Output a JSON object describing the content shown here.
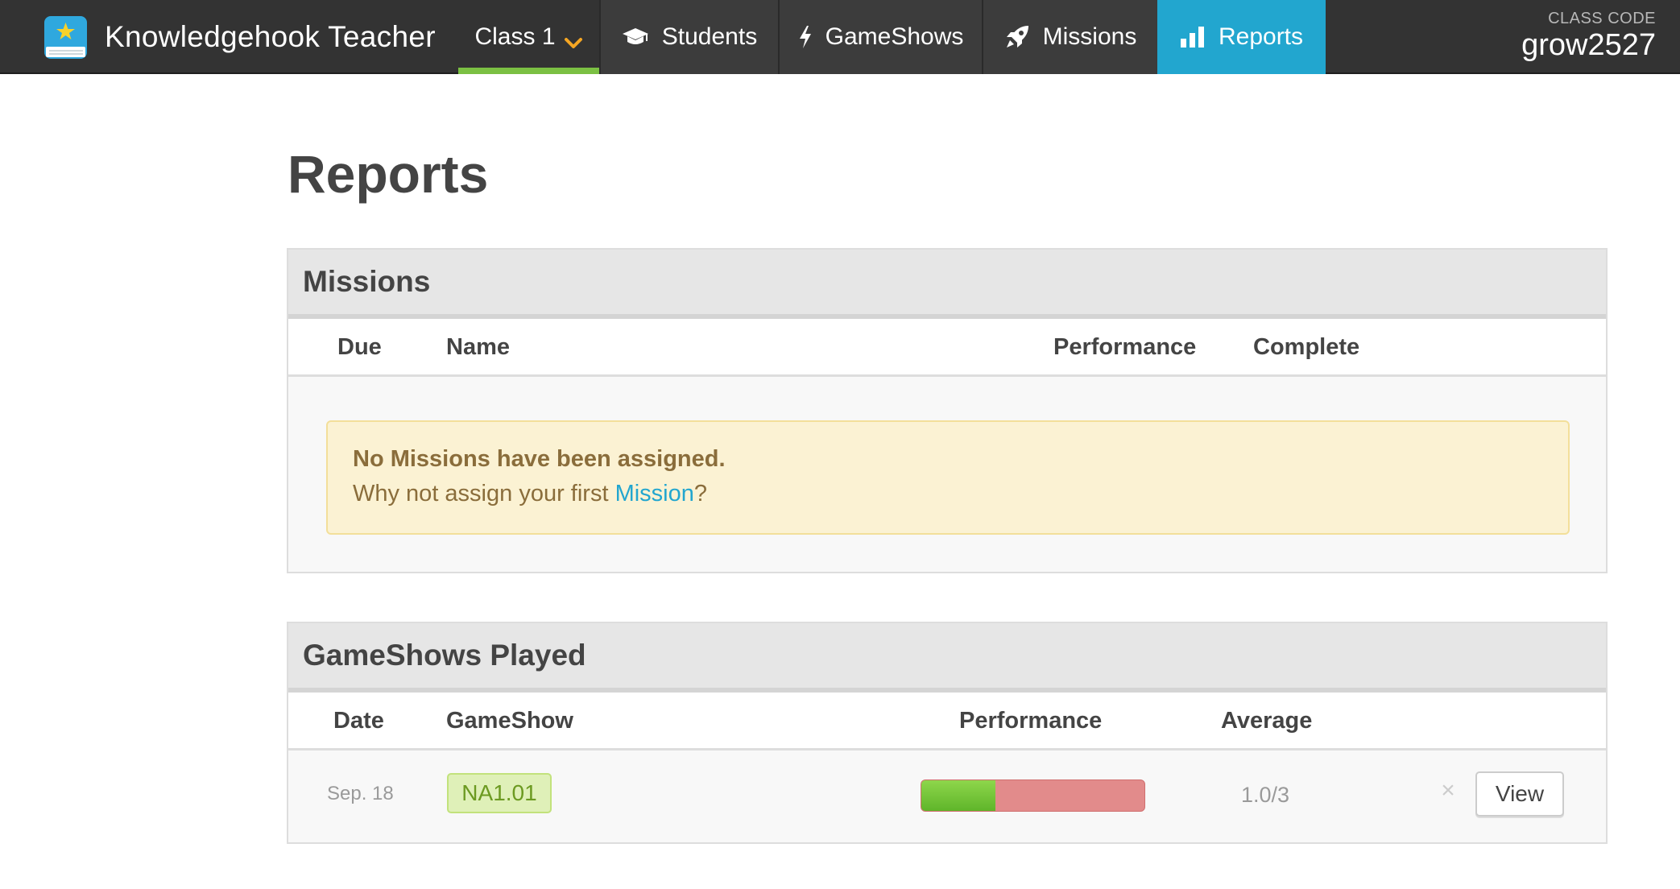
{
  "brand": {
    "name": "Knowledgehook Teacher"
  },
  "nav": {
    "class_selector": "Class 1",
    "tabs": [
      {
        "label": "Students",
        "icon": "graduation-cap-icon"
      },
      {
        "label": "GameShows",
        "icon": "lightning-bolt-icon"
      },
      {
        "label": "Missions",
        "icon": "rocket-icon"
      },
      {
        "label": "Reports",
        "icon": "bar-chart-icon",
        "active": true
      }
    ],
    "class_code_label": "CLASS CODE",
    "class_code": "grow2527"
  },
  "colors": {
    "topbar": "#333333",
    "active_tab": "#22a6cf",
    "class_underline": "#7bc043",
    "chevron": "#f5a623",
    "notice_bg": "#fbf2d3",
    "notice_text": "#8a6d3b",
    "link": "#22a6cf",
    "perf_good": "#6cc532",
    "perf_bad": "#e28b8b"
  },
  "page": {
    "title": "Reports"
  },
  "missions": {
    "heading": "Missions",
    "columns": [
      "Due",
      "Name",
      "Performance",
      "Complete"
    ],
    "empty_title": "No Missions have been assigned.",
    "empty_text_before": "Why not assign your first ",
    "empty_link": "Mission",
    "empty_text_after": "?"
  },
  "gameshows": {
    "heading": "GameShows Played",
    "columns": [
      "Date",
      "GameShow",
      "Performance",
      "Average"
    ],
    "rows": [
      {
        "date": "Sep. 18",
        "gameshow": "NA1.01",
        "performance_fraction": 0.333,
        "average": "1.0/3",
        "remove_symbol": "×",
        "view_label": "View"
      }
    ]
  }
}
